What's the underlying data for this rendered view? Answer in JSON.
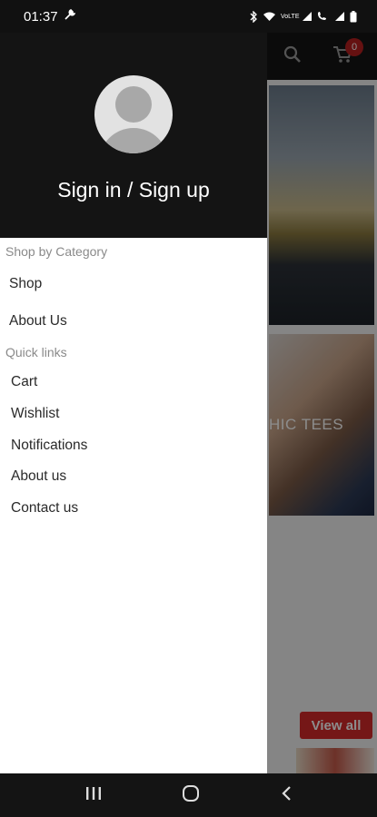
{
  "status_bar": {
    "time": "01:37",
    "network_label": "VoLTE"
  },
  "app": {
    "cart_count": "0",
    "banner_text": "HIC TEES",
    "view_all_label": "View all"
  },
  "drawer": {
    "sign_in_label": "Sign in / Sign up",
    "category_title": "Shop by Category",
    "category_items": [
      "Shop",
      "About Us"
    ],
    "quick_links_title": "Quick links",
    "quick_links": [
      "Cart",
      "Wishlist",
      "Notifications",
      "About us",
      "Contact us"
    ]
  },
  "colors": {
    "accent": "#d62a2a",
    "header_bg": "#141414"
  }
}
